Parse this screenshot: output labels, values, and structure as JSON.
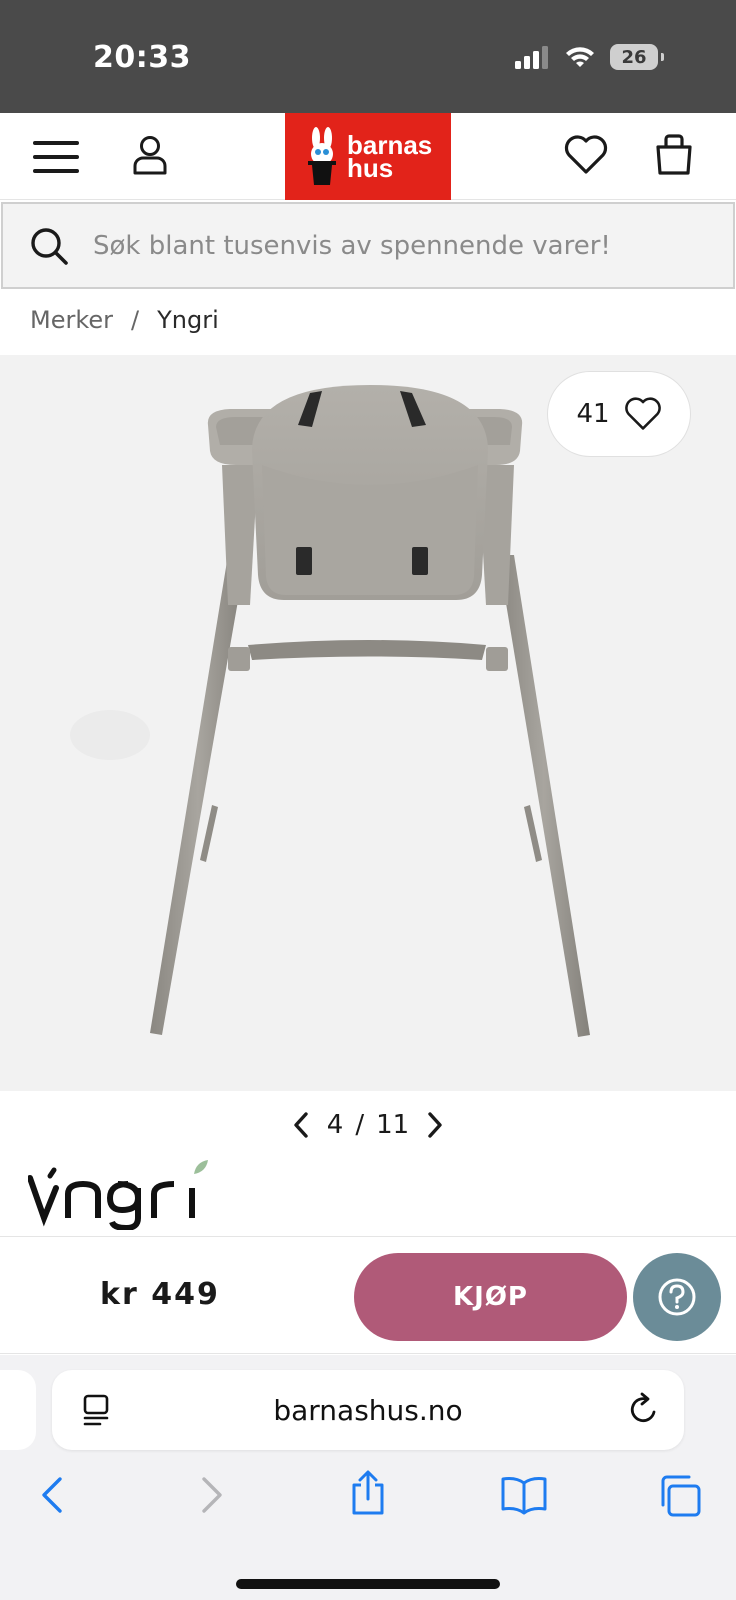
{
  "status_bar": {
    "time": "20:33",
    "battery": "26"
  },
  "header": {
    "logo_line1": "barnas",
    "logo_line2": "hus"
  },
  "search": {
    "placeholder": "Søk blant tusenvis av spennende varer!"
  },
  "breadcrumb": {
    "items": [
      "Merker",
      "Yngri"
    ],
    "separator": "/"
  },
  "product": {
    "likes": "41",
    "image_index": "4",
    "image_total": "11",
    "pager_separator": "/",
    "brand": "Yngri"
  },
  "buy_bar": {
    "price": "kr 449",
    "buy_label": "KJØP"
  },
  "browser": {
    "url": "barnashus.no"
  },
  "colors": {
    "brand_red": "#e2231a",
    "buy_button": "#b05a78",
    "help_button": "#6b8c98",
    "safari_blue": "#1e7cf0"
  }
}
